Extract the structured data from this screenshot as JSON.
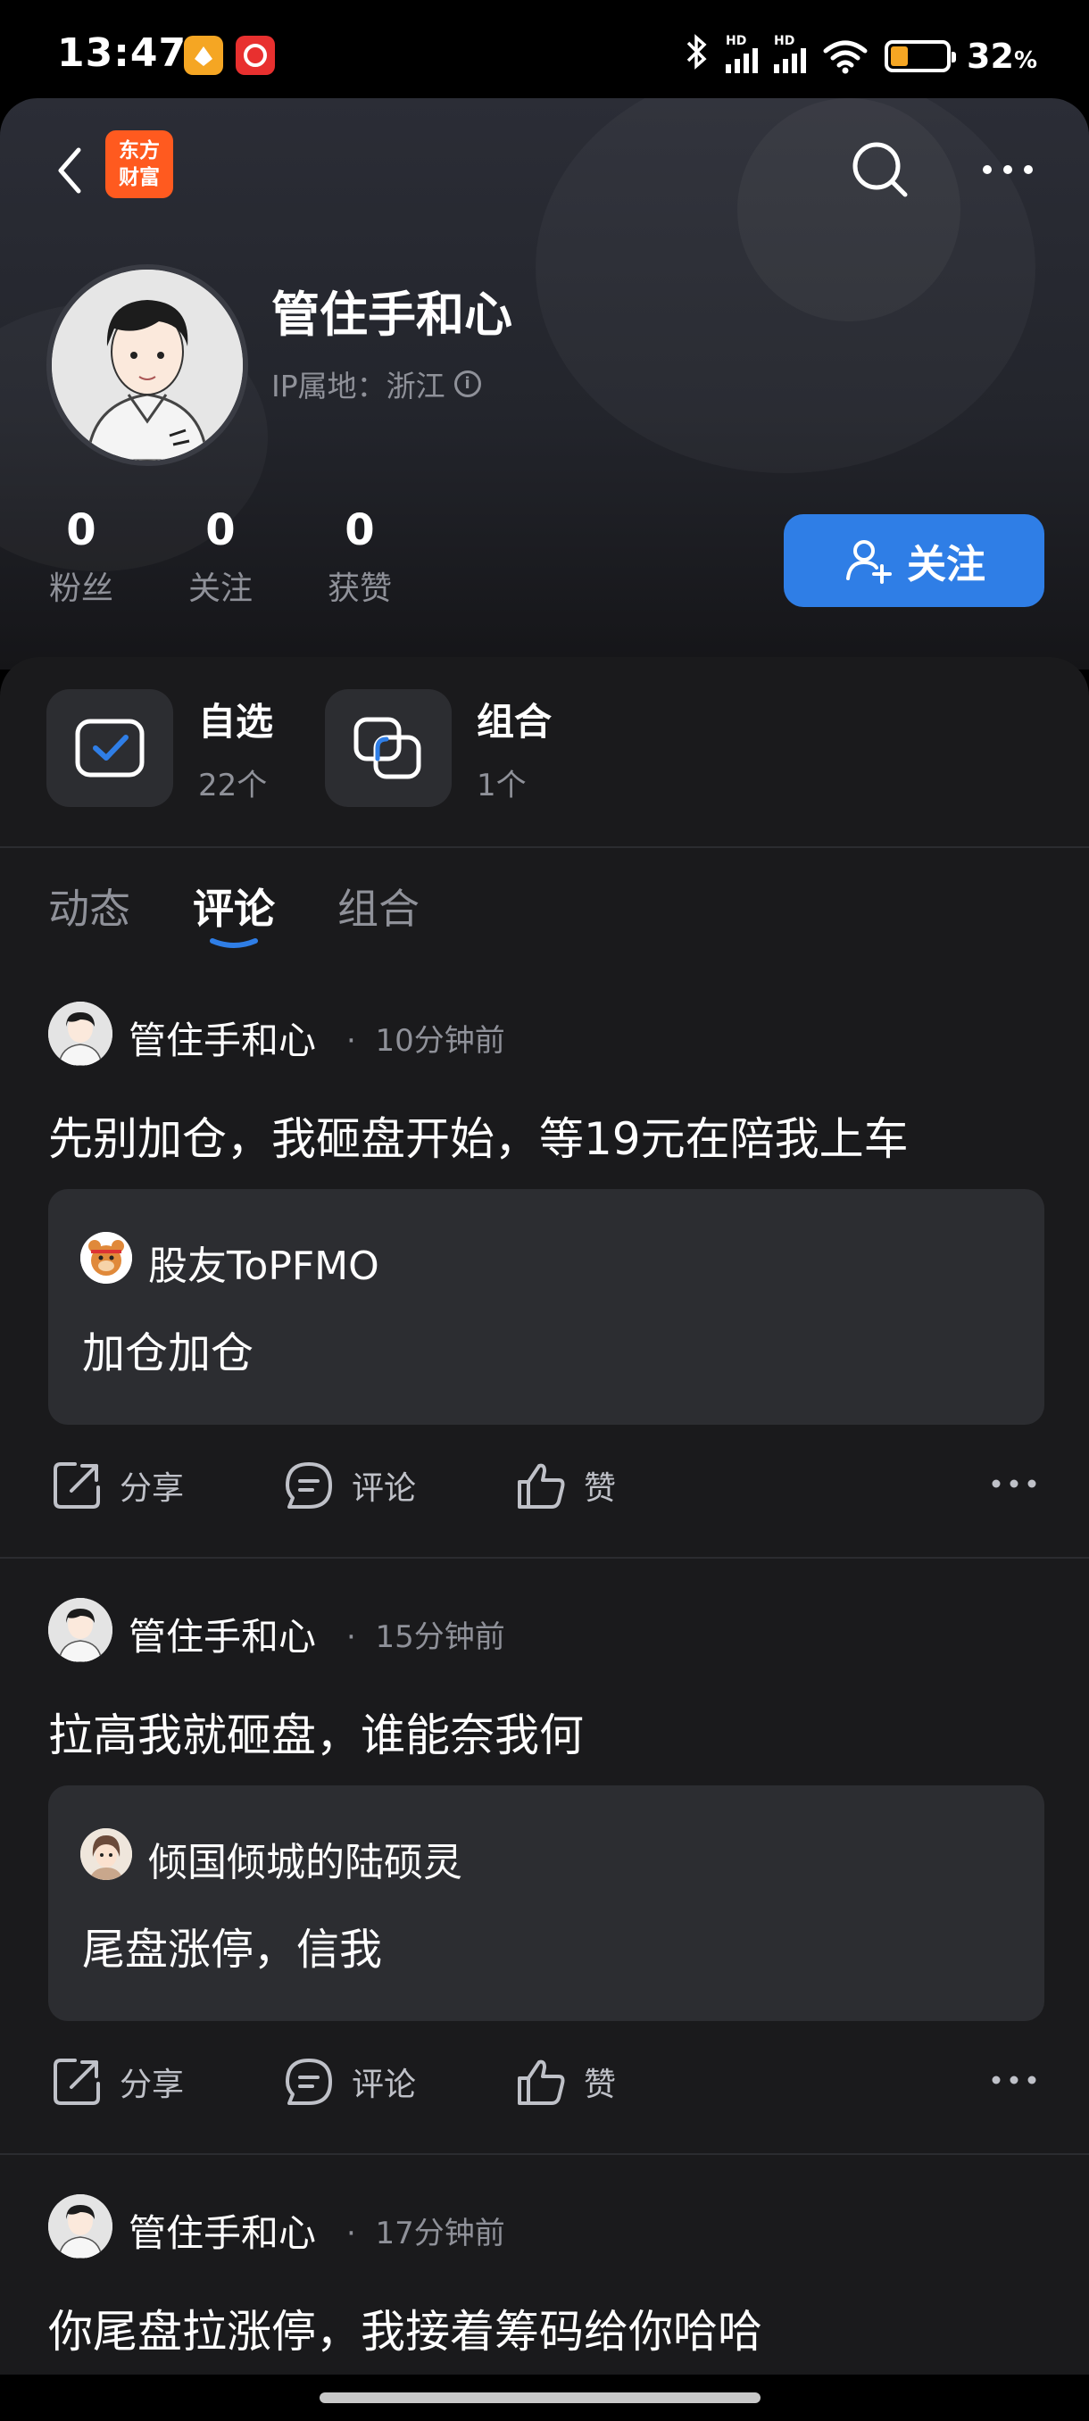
{
  "status_bar": {
    "time": "13:47",
    "battery_percent": "32",
    "battery_suffix": "%",
    "battery_level": 0.32,
    "hd_label": "HD",
    "icons": [
      "app-icon-orange",
      "app-icon-red",
      "bluetooth-icon",
      "signal-icon",
      "signal-icon",
      "wifi-icon",
      "battery-icon"
    ]
  },
  "header": {
    "logo_line1": "东方",
    "logo_line2": "财富",
    "username": "管住手和心",
    "ip_location": "IP属地：浙江",
    "stats": [
      {
        "value": "0",
        "label": "粉丝"
      },
      {
        "value": "0",
        "label": "关注"
      },
      {
        "value": "0",
        "label": "获赞"
      }
    ],
    "follow_label": "关注",
    "accent_color": "#2f7ee6"
  },
  "quick_links": [
    {
      "title": "自选",
      "subtitle": "22个"
    },
    {
      "title": "组合",
      "subtitle": "1个"
    }
  ],
  "tabs": [
    {
      "label": "动态",
      "active": false
    },
    {
      "label": "评论",
      "active": true
    },
    {
      "label": "组合",
      "active": false
    }
  ],
  "posts": [
    {
      "author": "管住手和心",
      "time": "10分钟前",
      "text": "先别加仓，我砸盘开始，等19元在陪我上车",
      "quote": {
        "author": "股友ToPFMO",
        "text": "加仓加仓"
      }
    },
    {
      "author": "管住手和心",
      "time": "15分钟前",
      "text": "拉高我就砸盘，谁能奈我何",
      "quote": {
        "author": "倾国倾城的陆硕灵",
        "text": "尾盘涨停，信我"
      }
    },
    {
      "author": "管住手和心",
      "time": "17分钟前",
      "text": "你尾盘拉涨停，我接着筹码给你哈哈"
    }
  ],
  "actions": {
    "share": "分享",
    "comment": "评论",
    "like": "赞"
  },
  "time_separator": "·"
}
